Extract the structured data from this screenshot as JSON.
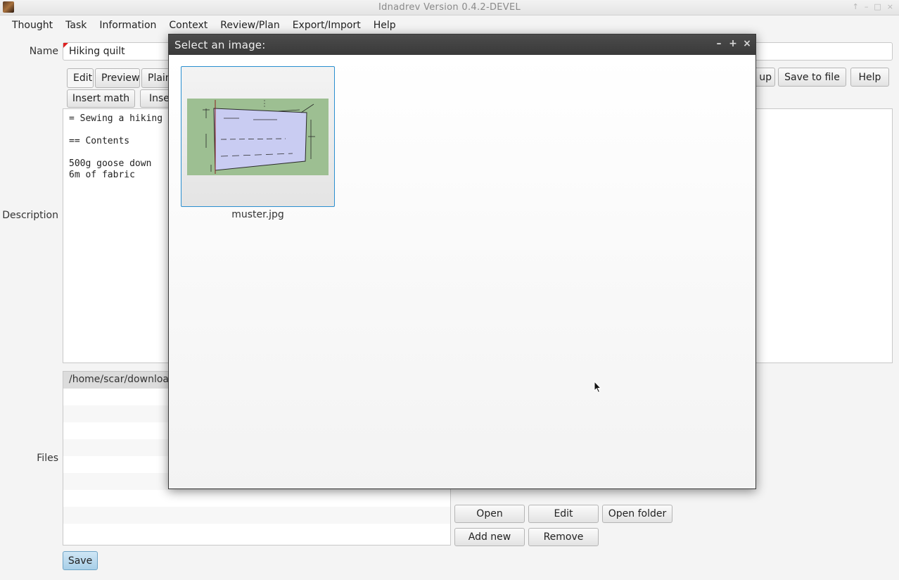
{
  "window": {
    "title": "Idnadrev Version 0.4.2-DEVEL"
  },
  "menubar": {
    "items": [
      "Thought",
      "Task",
      "Information",
      "Context",
      "Review/Plan",
      "Export/Import",
      "Help"
    ]
  },
  "form": {
    "name_label": "Name",
    "name_value": "Hiking quilt",
    "description_label": "Description",
    "files_label": "Files",
    "tabs": [
      "Edit",
      "Preview",
      "Plain"
    ],
    "toolbar_right": [
      "up",
      "Save to file",
      "Help"
    ],
    "insert_buttons": [
      "Insert math",
      "Inse"
    ],
    "description_text": "= Sewing a hiking\n\n== Contents\n\n500g goose down\n6m of fabric",
    "files_header": "/home/scar/download",
    "file_buttons": {
      "open": "Open",
      "edit": "Edit",
      "open_folder": "Open folder",
      "add_new": "Add new",
      "remove": "Remove"
    },
    "save_label": "Save"
  },
  "dialog": {
    "title": "Select an image:",
    "controls": [
      "–",
      "+",
      "×"
    ],
    "images": [
      {
        "filename": "muster.jpg"
      }
    ]
  }
}
